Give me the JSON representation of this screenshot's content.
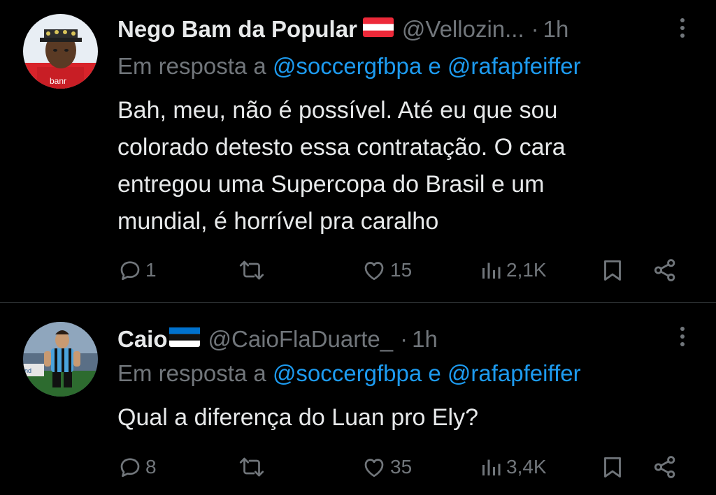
{
  "tweets": [
    {
      "display_name": "Nego Bam da Popular",
      "flag": "austria-flag",
      "handle": "@Vellozin...",
      "dot": "·",
      "time": "1h",
      "reply_prefix": "Em resposta a",
      "mention_1": "@soccergfbpa",
      "reply_and": "e",
      "mention_2": "@rafapfeiffer",
      "text_lines": [
        "Bah, meu, não é possível. Até eu que sou",
        "colorado detesto essa contratação. O cara",
        "entregou uma Supercopa do Brasil e um",
        "mundial, é horrível pra caralho"
      ],
      "replies": "1",
      "retweets": "",
      "likes": "15",
      "views": "2,1K"
    },
    {
      "display_name": "Caio",
      "flag": "estonia-flag",
      "handle": "@CaioFlaDuarte_",
      "dot": "·",
      "time": "1h",
      "reply_prefix": "Em resposta a",
      "mention_1": "@soccergfbpa",
      "reply_and": "e",
      "mention_2": "@rafapfeiffer",
      "text_lines": [
        "Qual a diferença do Luan pro Ely?"
      ],
      "replies": "8",
      "retweets": "",
      "likes": "35",
      "views": "3,4K"
    }
  ],
  "colors": {
    "background": "#000000",
    "text": "#e7e9ea",
    "secondary": "#71767b",
    "link": "#1d9bf0",
    "divider": "#2f3336"
  }
}
